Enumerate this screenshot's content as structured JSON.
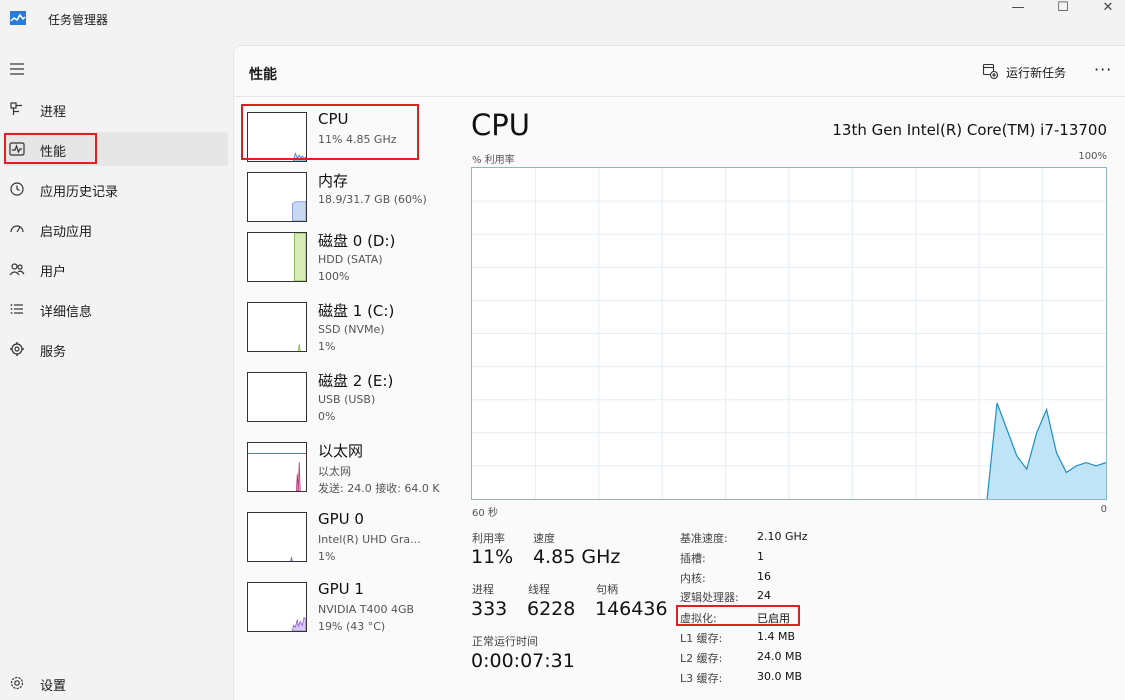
{
  "window": {
    "title": "任务管理器",
    "minimize": "—",
    "maximize": "☐",
    "close": "✕"
  },
  "sidebar": {
    "items": [
      {
        "label": "进程",
        "icon": "processes-icon"
      },
      {
        "label": "性能",
        "icon": "performance-icon",
        "active": true
      },
      {
        "label": "应用历史记录",
        "icon": "app-history-icon"
      },
      {
        "label": "启动应用",
        "icon": "startup-icon"
      },
      {
        "label": "用户",
        "icon": "users-icon"
      },
      {
        "label": "详细信息",
        "icon": "details-icon"
      },
      {
        "label": "服务",
        "icon": "services-icon"
      }
    ],
    "settings": "设置"
  },
  "header": {
    "title": "性能",
    "run_task": "运行新任务",
    "more": "···"
  },
  "devices": [
    {
      "name": "CPU",
      "line1": "11% 4.85 GHz",
      "line2": "",
      "color": "#1a8fc9"
    },
    {
      "name": "内存",
      "line1": "18.9/31.7 GB (60%)",
      "line2": "",
      "color": "#6f8fcf"
    },
    {
      "name": "磁盘 0 (D:)",
      "line1": "HDD (SATA)",
      "line2": "100%",
      "color": "#7cb342"
    },
    {
      "name": "磁盘 1 (C:)",
      "line1": "SSD (NVMe)",
      "line2": "1%",
      "color": "#7cb342"
    },
    {
      "name": "磁盘 2 (E:)",
      "line1": "USB (USB)",
      "line2": "0%",
      "color": "#7cb342"
    },
    {
      "name": "以太网",
      "line1": "以太网",
      "line2": "发送: 24.0  接收: 64.0 K",
      "color": "#b5367a"
    },
    {
      "name": "GPU 0",
      "line1": "Intel(R) UHD Gra...",
      "line2": "1%",
      "color": "#8a5bd6"
    },
    {
      "name": "GPU 1",
      "line1": "NVIDIA T400 4GB",
      "line2": "19% (43 °C)",
      "color": "#8a5bd6"
    }
  ],
  "detail": {
    "title": "CPU",
    "model": "13th Gen Intel(R) Core(TM) i7-13700",
    "graph_label": "% 利用率",
    "graph_max": "100%",
    "time_label": "60 秒",
    "time_end": "0",
    "usage_pct": [
      0,
      0,
      0,
      0,
      0,
      0,
      0,
      0,
      0,
      0,
      0,
      0,
      0,
      0,
      0,
      0,
      0,
      0,
      0,
      0,
      0,
      0,
      0,
      0,
      0,
      0,
      0,
      0,
      0,
      0,
      0,
      0,
      0,
      0,
      0,
      0,
      0,
      0,
      0,
      0,
      0,
      0,
      0,
      0,
      0,
      0,
      0,
      0,
      0,
      0,
      0,
      0,
      0,
      29,
      21,
      13,
      9,
      20,
      27,
      14,
      8,
      10,
      11,
      10,
      11
    ]
  },
  "stats": {
    "utilization_label": "利用率",
    "utilization": "11%",
    "speed_label": "速度",
    "speed": "4.85 GHz",
    "processes_label": "进程",
    "processes": "333",
    "threads_label": "线程",
    "threads": "6228",
    "handles_label": "句柄",
    "handles": "146436",
    "uptime_label": "正常运行时间",
    "uptime": "0:00:07:31"
  },
  "specs": [
    {
      "label": "基准速度:",
      "value": "2.10 GHz"
    },
    {
      "label": "插槽:",
      "value": "1"
    },
    {
      "label": "内核:",
      "value": "16"
    },
    {
      "label": "逻辑处理器:",
      "value": "24"
    },
    {
      "label": "虚拟化:",
      "value": "已启用"
    },
    {
      "label": "L1 缓存:",
      "value": "1.4 MB"
    },
    {
      "label": "L2 缓存:",
      "value": "24.0 MB"
    },
    {
      "label": "L3 缓存:",
      "value": "30.0 MB"
    }
  ]
}
